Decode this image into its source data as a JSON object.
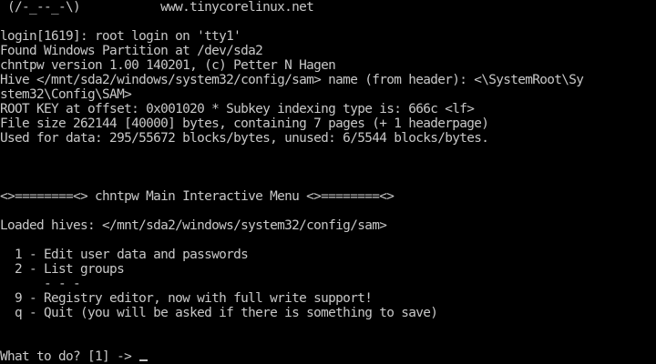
{
  "terminal": {
    "banner": " (/-_--_-\\)           www.tinycorelinux.net",
    "boot": [
      "login[1619]: root login on 'tty1'",
      "Found Windows Partition at /dev/sda2",
      "chntpw version 1.00 140201, (c) Petter N Hagen",
      "Hive </mnt/sda2/windows/system32/config/sam> name (from header): <\\SystemRoot\\Sy",
      "stem32\\Config\\SAM>",
      "ROOT KEY at offset: 0x001020 * Subkey indexing type is: 666c <lf>",
      "File size 262144 [40000] bytes, containing 7 pages (+ 1 headerpage)",
      "Used for data: 295/55672 blocks/bytes, unused: 6/5544 blocks/bytes."
    ],
    "menu_title": "<>========<> chntpw Main Interactive Menu <>========<>",
    "loaded_hives": "Loaded hives: </mnt/sda2/windows/system32/config/sam>",
    "options": [
      "  1 - Edit user data and passwords",
      "  2 - List groups",
      "      - - -",
      "  9 - Registry editor, now with full write support!",
      "  q - Quit (you will be asked if there is something to save)"
    ],
    "prompt": "What to do? [1] -> "
  }
}
